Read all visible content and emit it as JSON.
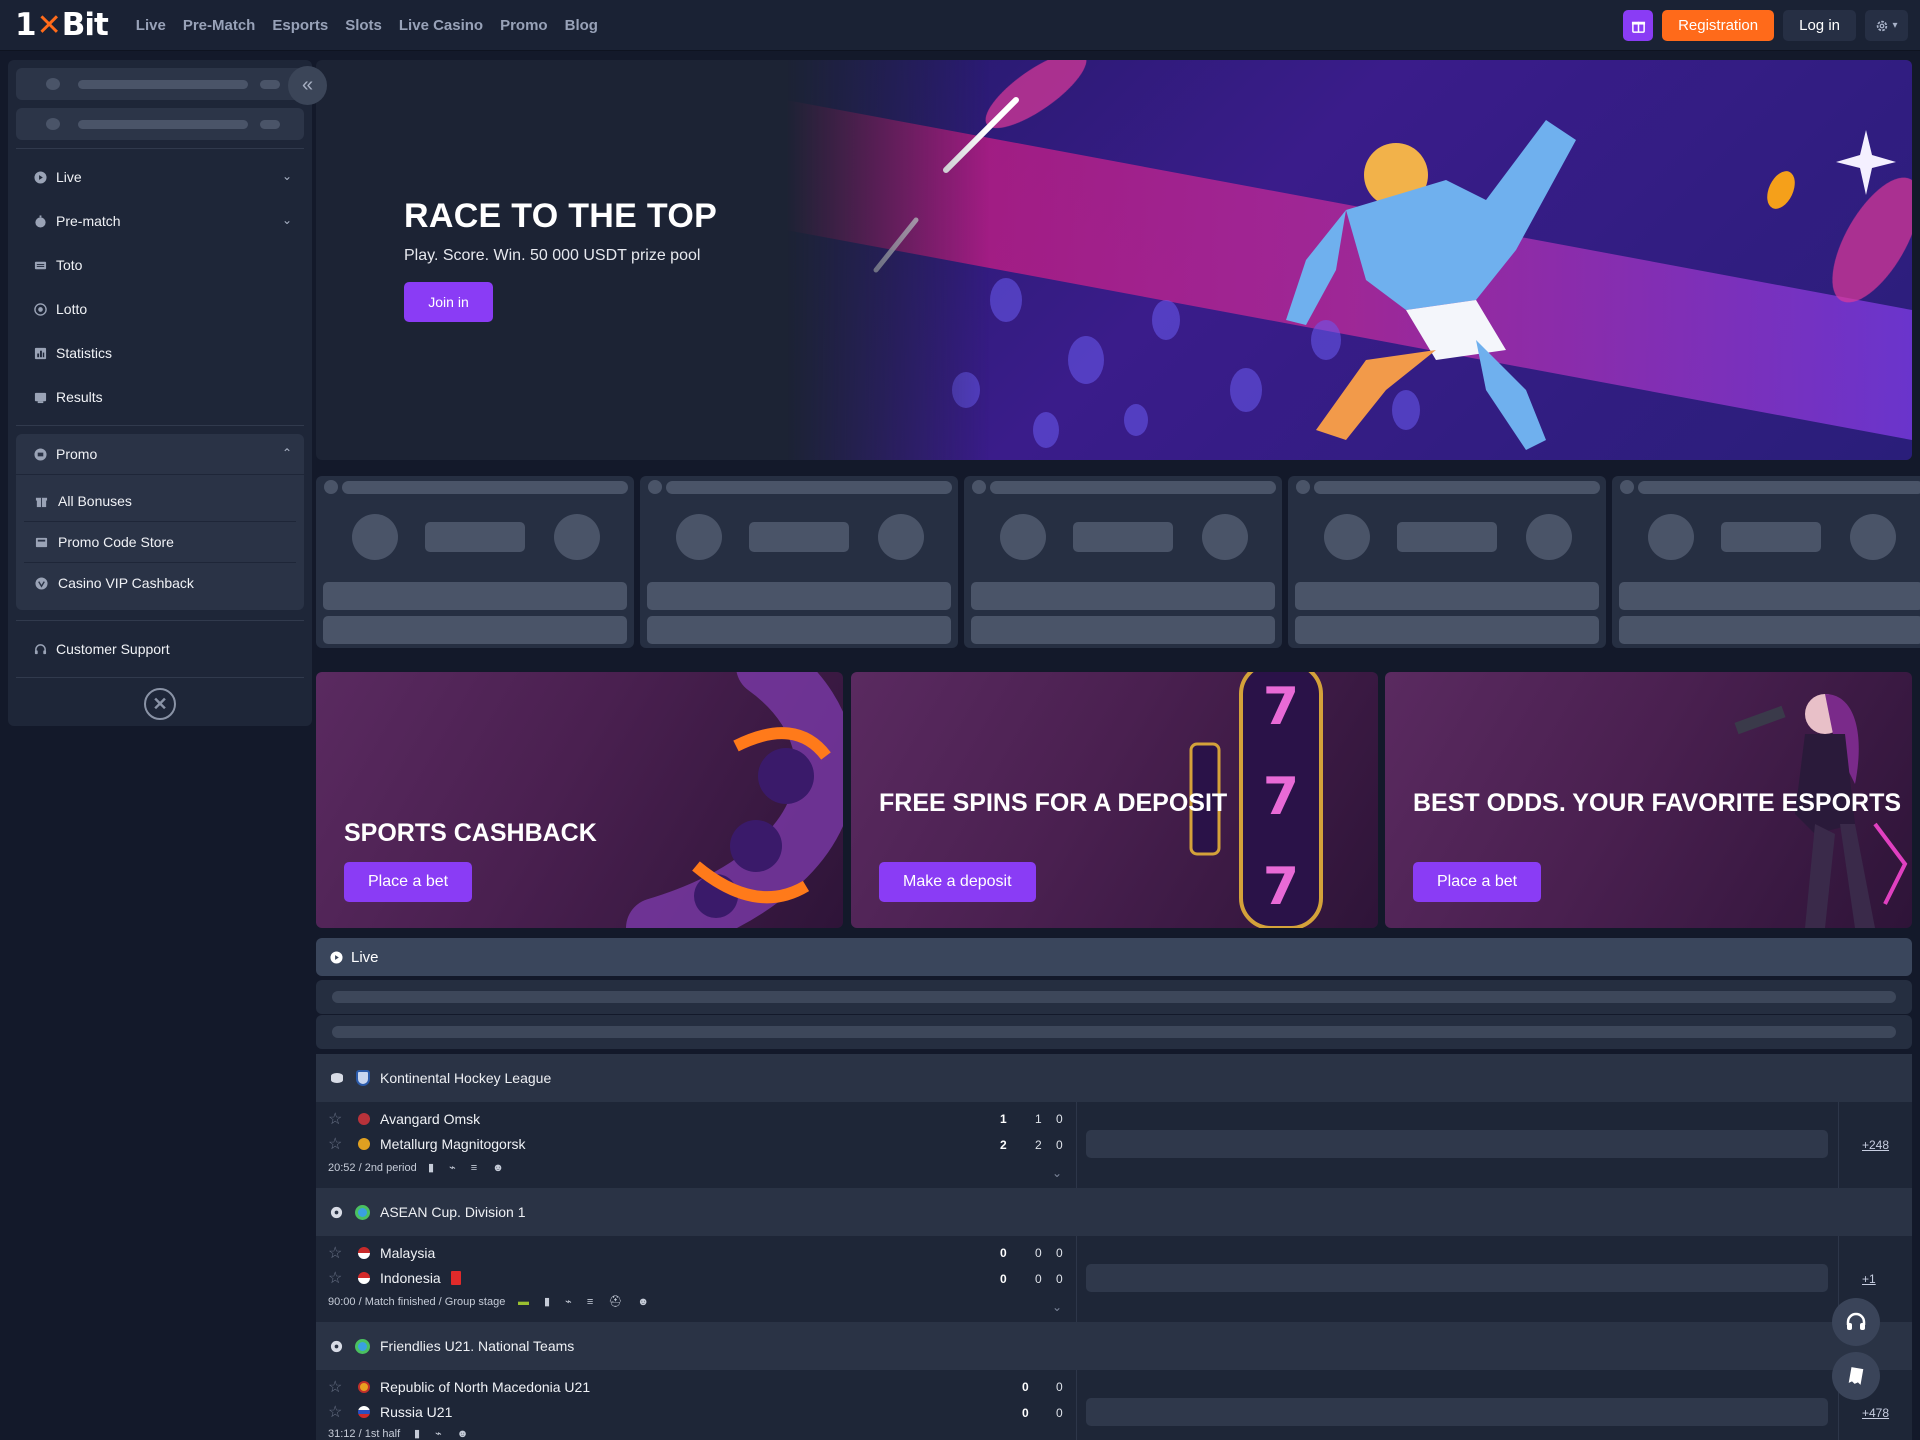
{
  "header": {
    "logo_left": "1",
    "logo_x": "✕",
    "logo_right": "Bit",
    "nav": [
      "Live",
      "Pre-Match",
      "Esports",
      "Slots",
      "Live Casino",
      "Promo",
      "Blog"
    ],
    "registration": "Registration",
    "login": "Log in",
    "gift_icon": "gift-icon",
    "settings_icon": "gear-icon"
  },
  "sidebar": {
    "collapse_icon": "«",
    "items": [
      {
        "label": "Live",
        "icon": "play-icon",
        "chevron": "⌄"
      },
      {
        "label": "Pre-match",
        "icon": "stopwatch-icon",
        "chevron": "⌄"
      },
      {
        "label": "Toto",
        "icon": "ticket-icon"
      },
      {
        "label": "Lotto",
        "icon": "lotto-icon"
      },
      {
        "label": "Statistics",
        "icon": "statistics-icon"
      },
      {
        "label": "Results",
        "icon": "results-icon"
      }
    ],
    "promo": {
      "label": "Promo",
      "chevron": "⌃",
      "items": [
        {
          "label": "All Bonuses",
          "icon": "gift-icon"
        },
        {
          "label": "Promo Code Store",
          "icon": "store-icon"
        },
        {
          "label": "Casino VIP Cashback",
          "icon": "vip-icon"
        }
      ]
    },
    "support": "Customer Support"
  },
  "hero": {
    "title": "RACE TO THE TOP",
    "subtitle": "Play. Score. Win. 50 000 USDT prize pool",
    "button": "Join in"
  },
  "banners": [
    {
      "title": "SPORTS CASHBACK",
      "button": "Place a bet"
    },
    {
      "title": "FREE SPINS FOR A DEPOSIT",
      "button": "Make a deposit"
    },
    {
      "title": "BEST ODDS. YOUR FAVORITE ESPORTS",
      "button": "Place a bet"
    }
  ],
  "live": {
    "label": "Live",
    "leagues": [
      {
        "name": "Kontinental Hockey League",
        "teams": [
          {
            "name": "Avangard Omsk",
            "scores": [
              "1",
              "1",
              "0"
            ]
          },
          {
            "name": "Metallurg Magnitogorsk",
            "scores": [
              "2",
              "2",
              "0"
            ]
          }
        ],
        "meta": "20:52 / 2nd period",
        "more": "+248"
      },
      {
        "name": "ASEAN Cup. Division 1",
        "teams": [
          {
            "name": "Malaysia",
            "scores": [
              "0",
              "0",
              "0"
            ]
          },
          {
            "name": "Indonesia",
            "scores": [
              "0",
              "0",
              "0"
            ]
          }
        ],
        "meta": "90:00 / Match finished / Group stage",
        "more": "+1"
      },
      {
        "name": "Friendlies U21. National Teams",
        "teams": [
          {
            "name": "Republic of North Macedonia U21",
            "scores": [
              "0",
              "0"
            ]
          },
          {
            "name": "Russia U21",
            "scores": [
              "0",
              "0"
            ]
          }
        ],
        "meta": "31:12 / 1st half",
        "more": "+478"
      }
    ]
  },
  "colors": {
    "accent": "#8a3cf5",
    "registration": "#ff6a1a",
    "bg": "#13192a",
    "panel": "#1e2638"
  }
}
